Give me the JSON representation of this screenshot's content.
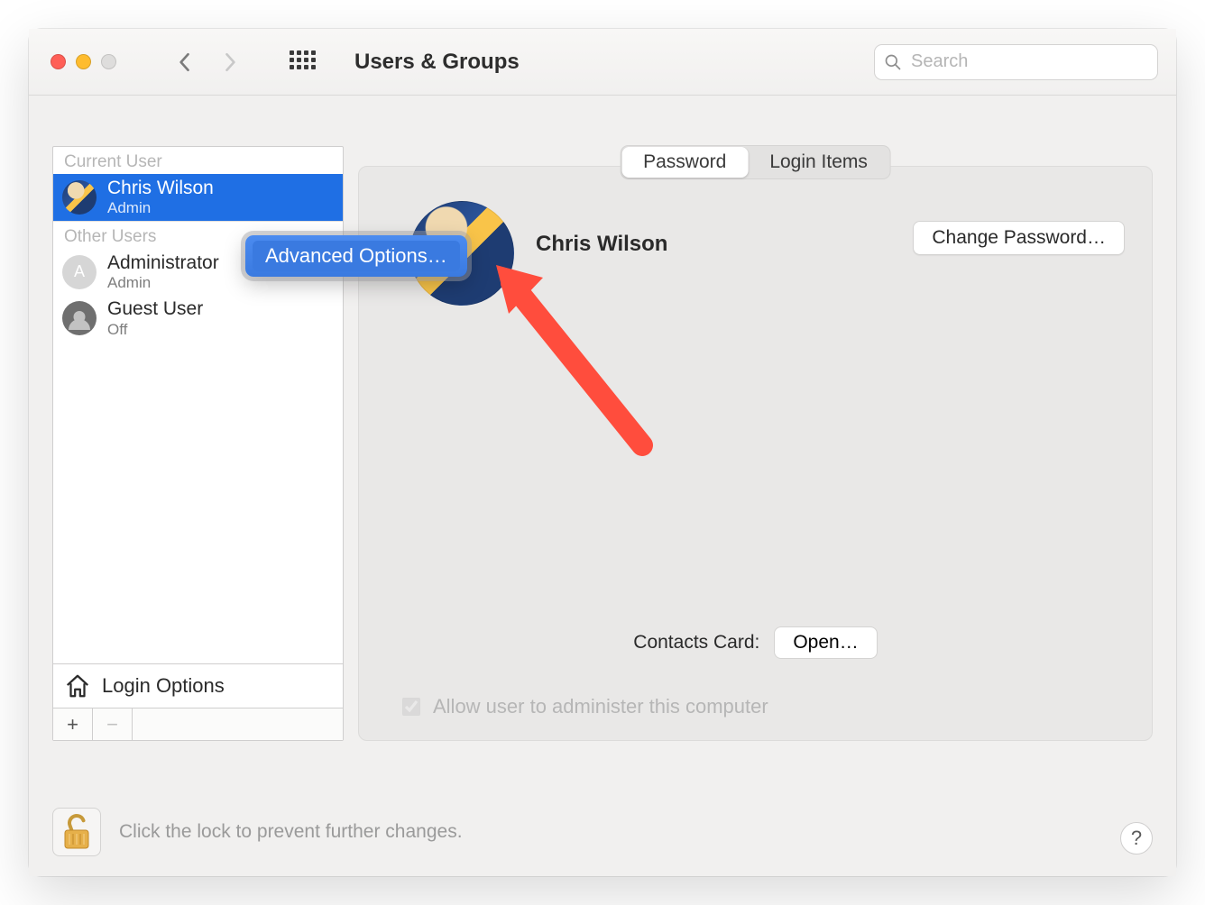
{
  "toolbar": {
    "title": "Users & Groups",
    "search_placeholder": "Search"
  },
  "sidebar": {
    "current_user_label": "Current User",
    "other_users_label": "Other Users",
    "users": [
      {
        "name": "Chris Wilson",
        "role": "Admin",
        "avatar": "chris",
        "selected": true
      },
      {
        "name": "Administrator",
        "role": "Admin",
        "avatar_initial": "A",
        "selected": false
      },
      {
        "name": "Guest User",
        "role": "Off",
        "avatar": "guest",
        "selected": false
      }
    ],
    "login_options_label": "Login Options"
  },
  "context_menu": {
    "item": "Advanced Options…"
  },
  "main": {
    "tabs": {
      "password": "Password",
      "login_items": "Login Items"
    },
    "display_name": "Chris Wilson",
    "change_password_label": "Change Password…",
    "contacts_card_label": "Contacts Card:",
    "open_label": "Open…",
    "admin_checkbox_label": "Allow user to administer this computer",
    "admin_checked": true
  },
  "footer": {
    "lock_text": "Click the lock to prevent further changes.",
    "help_label": "?"
  }
}
